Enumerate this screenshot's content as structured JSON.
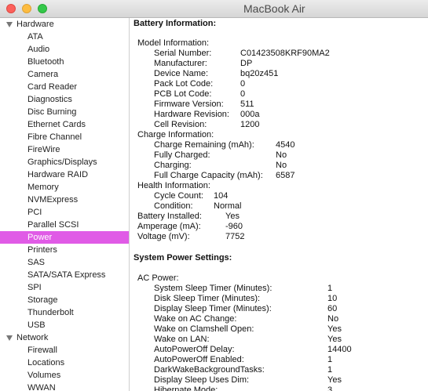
{
  "window": {
    "title": "MacBook Air"
  },
  "sidebar": {
    "hardware_label": "Hardware",
    "hardware_items": [
      "ATA",
      "Audio",
      "Bluetooth",
      "Camera",
      "Card Reader",
      "Diagnostics",
      "Disc Burning",
      "Ethernet Cards",
      "Fibre Channel",
      "FireWire",
      "Graphics/Displays",
      "Hardware RAID",
      "Memory",
      "NVMExpress",
      "PCI",
      "Parallel SCSI",
      "Power",
      "Printers",
      "SAS",
      "SATA/SATA Express",
      "SPI",
      "Storage",
      "Thunderbolt",
      "USB"
    ],
    "selected": "Power",
    "network_label": "Network",
    "network_items": [
      "Firewall",
      "Locations",
      "Volumes",
      "WWAN"
    ]
  },
  "battery": {
    "title": "Battery Information:",
    "model_header": "Model Information:",
    "model": [
      [
        "Serial Number:",
        "C01423508KRF90MA2"
      ],
      [
        "Manufacturer:",
        "DP"
      ],
      [
        "Device Name:",
        "bq20z451"
      ],
      [
        "Pack Lot Code:",
        "0"
      ],
      [
        "PCB Lot Code:",
        "0"
      ],
      [
        "Firmware Version:",
        "511"
      ],
      [
        "Hardware Revision:",
        "000a"
      ],
      [
        "Cell Revision:",
        "1200"
      ]
    ],
    "charge_header": "Charge Information:",
    "charge": [
      [
        "Charge Remaining (mAh):",
        "4540"
      ],
      [
        "Fully Charged:",
        "No"
      ],
      [
        "Charging:",
        "No"
      ],
      [
        "Full Charge Capacity (mAh):",
        "6587"
      ]
    ],
    "health_header": "Health Information:",
    "health": [
      [
        "Cycle Count:",
        "104"
      ],
      [
        "Condition:",
        "Normal"
      ]
    ],
    "misc": [
      [
        "Battery Installed:",
        "Yes"
      ],
      [
        "Amperage (mA):",
        "-960"
      ],
      [
        "Voltage (mV):",
        "7752"
      ]
    ]
  },
  "power_settings": {
    "title": "System Power Settings:",
    "ac_header": "AC Power:",
    "ac": [
      [
        "System Sleep Timer (Minutes):",
        "1"
      ],
      [
        "Disk Sleep Timer (Minutes):",
        "10"
      ],
      [
        "Display Sleep Timer (Minutes):",
        "60"
      ],
      [
        "Wake on AC Change:",
        "No"
      ],
      [
        "Wake on Clamshell Open:",
        "Yes"
      ],
      [
        "Wake on LAN:",
        "Yes"
      ],
      [
        "AutoPowerOff Delay:",
        "14400"
      ],
      [
        "AutoPowerOff Enabled:",
        "1"
      ],
      [
        "DarkWakeBackgroundTasks:",
        "1"
      ],
      [
        "Display Sleep Uses Dim:",
        "Yes"
      ],
      [
        "Hibernate Mode:",
        "3"
      ]
    ]
  }
}
